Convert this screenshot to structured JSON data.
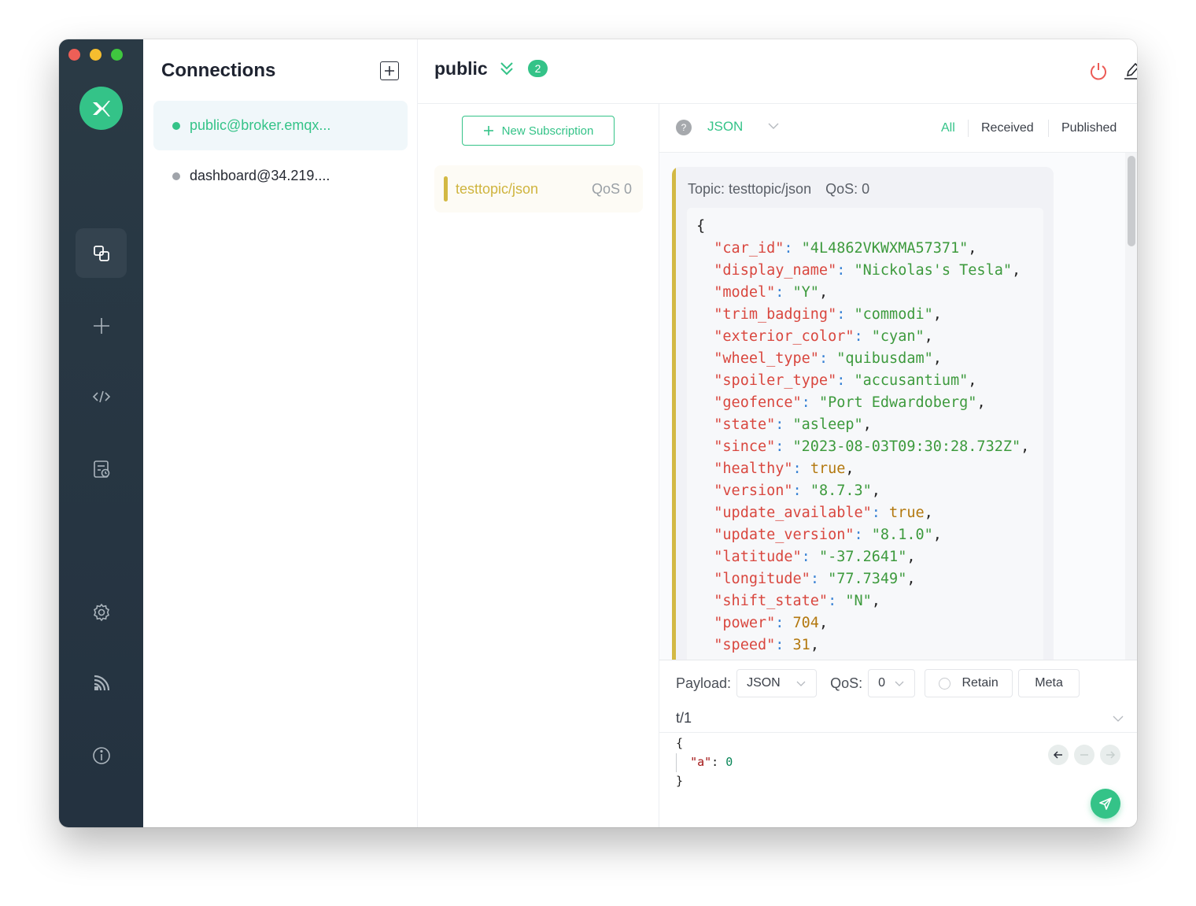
{
  "window": {
    "traffic_lights": [
      "close",
      "minimize",
      "zoom"
    ]
  },
  "rail": {
    "logo": "mqttx-logo",
    "items": [
      {
        "name": "connections",
        "icon": "connections-icon",
        "active": true
      },
      {
        "name": "new-connection",
        "icon": "plus-icon",
        "active": false
      },
      {
        "name": "script",
        "icon": "code-icon",
        "active": false
      },
      {
        "name": "log",
        "icon": "log-icon",
        "active": false
      },
      {
        "name": "settings",
        "icon": "gear-icon",
        "active": false
      },
      {
        "name": "subscribe-feed",
        "icon": "feed-icon",
        "active": false
      },
      {
        "name": "about",
        "icon": "info-icon",
        "active": false
      }
    ]
  },
  "connections": {
    "title": "Connections",
    "add_icon": "plus-square-icon",
    "items": [
      {
        "label": "public@broker.emqx...",
        "status": "connected",
        "status_color": "#34c388",
        "active": true
      },
      {
        "label": "dashboard@34.219....",
        "status": "disconnected",
        "status_color": "#a0a4aa",
        "active": false
      }
    ]
  },
  "header": {
    "connection_name": "public",
    "collapse_icon": "double-chevron-down-icon",
    "message_count": "2",
    "actions": {
      "disconnect_icon": "power-icon",
      "edit_icon": "pencil-icon",
      "more_icon": "ellipsis-icon"
    }
  },
  "subscriptions": {
    "new_button_label": "New Subscription",
    "items": [
      {
        "topic": "testtopic/json",
        "qos": "QoS 0",
        "color": "#d3b944"
      }
    ]
  },
  "messages_toolbar": {
    "help_icon": "question-circle-icon",
    "format": "JSON",
    "filters": [
      "All",
      "Received",
      "Published"
    ],
    "active_filter": "All"
  },
  "messages": [
    {
      "topic_label": "Topic: testtopic/json",
      "qos_label": "QoS: 0",
      "color": "#d3b944",
      "payload_lines": [
        {
          "type": "open",
          "text": "{"
        },
        {
          "key": "car_id",
          "value": "4L4862VKWXMA57371",
          "vtype": "string"
        },
        {
          "key": "display_name",
          "value": "Nickolas's Tesla",
          "vtype": "string"
        },
        {
          "key": "model",
          "value": "Y",
          "vtype": "string"
        },
        {
          "key": "trim_badging",
          "value": "commodi",
          "vtype": "string"
        },
        {
          "key": "exterior_color",
          "value": "cyan",
          "vtype": "string"
        },
        {
          "key": "wheel_type",
          "value": "quibusdam",
          "vtype": "string"
        },
        {
          "key": "spoiler_type",
          "value": "accusantium",
          "vtype": "string"
        },
        {
          "key": "geofence",
          "value": "Port Edwardoberg",
          "vtype": "string"
        },
        {
          "key": "state",
          "value": "asleep",
          "vtype": "string"
        },
        {
          "key": "since",
          "value": "2023-08-03T09:30:28.732Z",
          "vtype": "string"
        },
        {
          "key": "healthy",
          "value": "true",
          "vtype": "bool"
        },
        {
          "key": "version",
          "value": "8.7.3",
          "vtype": "string"
        },
        {
          "key": "update_available",
          "value": "true",
          "vtype": "bool"
        },
        {
          "key": "update_version",
          "value": "8.1.0",
          "vtype": "string"
        },
        {
          "key": "latitude",
          "value": "-37.2641",
          "vtype": "string"
        },
        {
          "key": "longitude",
          "value": "77.7349",
          "vtype": "string"
        },
        {
          "key": "shift_state",
          "value": "N",
          "vtype": "string"
        },
        {
          "key": "power",
          "value": "704",
          "vtype": "number"
        },
        {
          "key": "speed",
          "value": "31",
          "vtype": "number"
        }
      ]
    }
  ],
  "publish": {
    "payload_label": "Payload:",
    "payload_format": "JSON",
    "qos_label": "QoS:",
    "qos_value": "0",
    "retain_label": "Retain",
    "retain_checked": false,
    "meta_label": "Meta",
    "topic": "t/1",
    "editor_lines": [
      "{",
      "  \"a\": 0",
      "}"
    ],
    "editor_key": "\"a\"",
    "editor_value": "0",
    "history": {
      "prev_icon": "arrow-left-icon",
      "reset_icon": "minus-icon",
      "next_icon": "arrow-right-icon"
    },
    "send_icon": "send-icon"
  }
}
